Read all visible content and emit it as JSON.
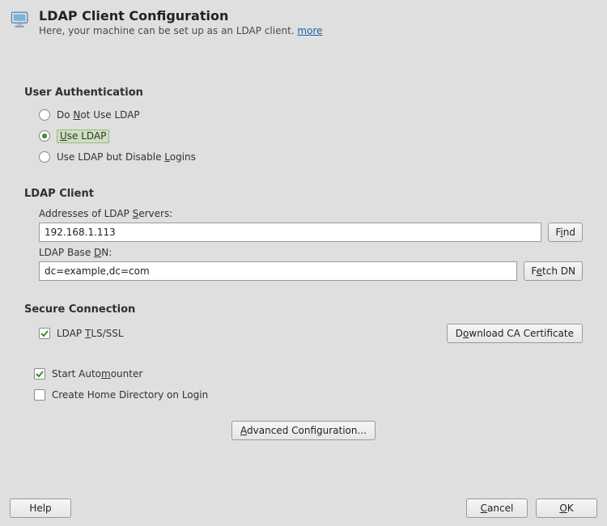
{
  "header": {
    "title": "LDAP Client Configuration",
    "subtitle_prefix": "Here, your machine can be set up as an LDAP client. ",
    "more_label": "more"
  },
  "sections": {
    "user_auth": "User Authentication",
    "ldap_client": "LDAP Client",
    "secure_conn": "Secure Connection"
  },
  "auth": {
    "opt_no_pre": "Do ",
    "opt_no_u": "N",
    "opt_no_post": "ot Use LDAP",
    "opt_use_u": "U",
    "opt_use_post": "se LDAP",
    "opt_disable_pre": "Use LDAP but Disable ",
    "opt_disable_u": "L",
    "opt_disable_post": "ogins",
    "selected": "use"
  },
  "client": {
    "addr_label_pre": "Addresses of LDAP ",
    "addr_label_u": "S",
    "addr_label_post": "ervers:",
    "addr_value": "192.168.1.113",
    "find_pre": "F",
    "find_u": "i",
    "find_post": "nd",
    "dn_label_pre": "LDAP Base ",
    "dn_label_u": "D",
    "dn_label_post": "N:",
    "dn_value": "dc=example,dc=com",
    "fetch_pre": "F",
    "fetch_u": "e",
    "fetch_post": "tch DN"
  },
  "secure": {
    "tls_pre": "LDAP ",
    "tls_u": "T",
    "tls_post": "LS/SSL",
    "tls_checked": true,
    "download_pre": "D",
    "download_u": "o",
    "download_post": "wnload CA Certificate"
  },
  "extra": {
    "automounter_pre": "Start Auto",
    "automounter_u": "m",
    "automounter_post": "ounter",
    "automounter_checked": true,
    "homedir_pre": "Create Home Directory on Login",
    "homedir_checked": false
  },
  "advanced": {
    "pre": "",
    "u": "A",
    "post": "dvanced Configuration..."
  },
  "footer": {
    "help": "Help",
    "cancel_u": "C",
    "cancel_post": "ancel",
    "ok_u": "O",
    "ok_post": "K"
  }
}
